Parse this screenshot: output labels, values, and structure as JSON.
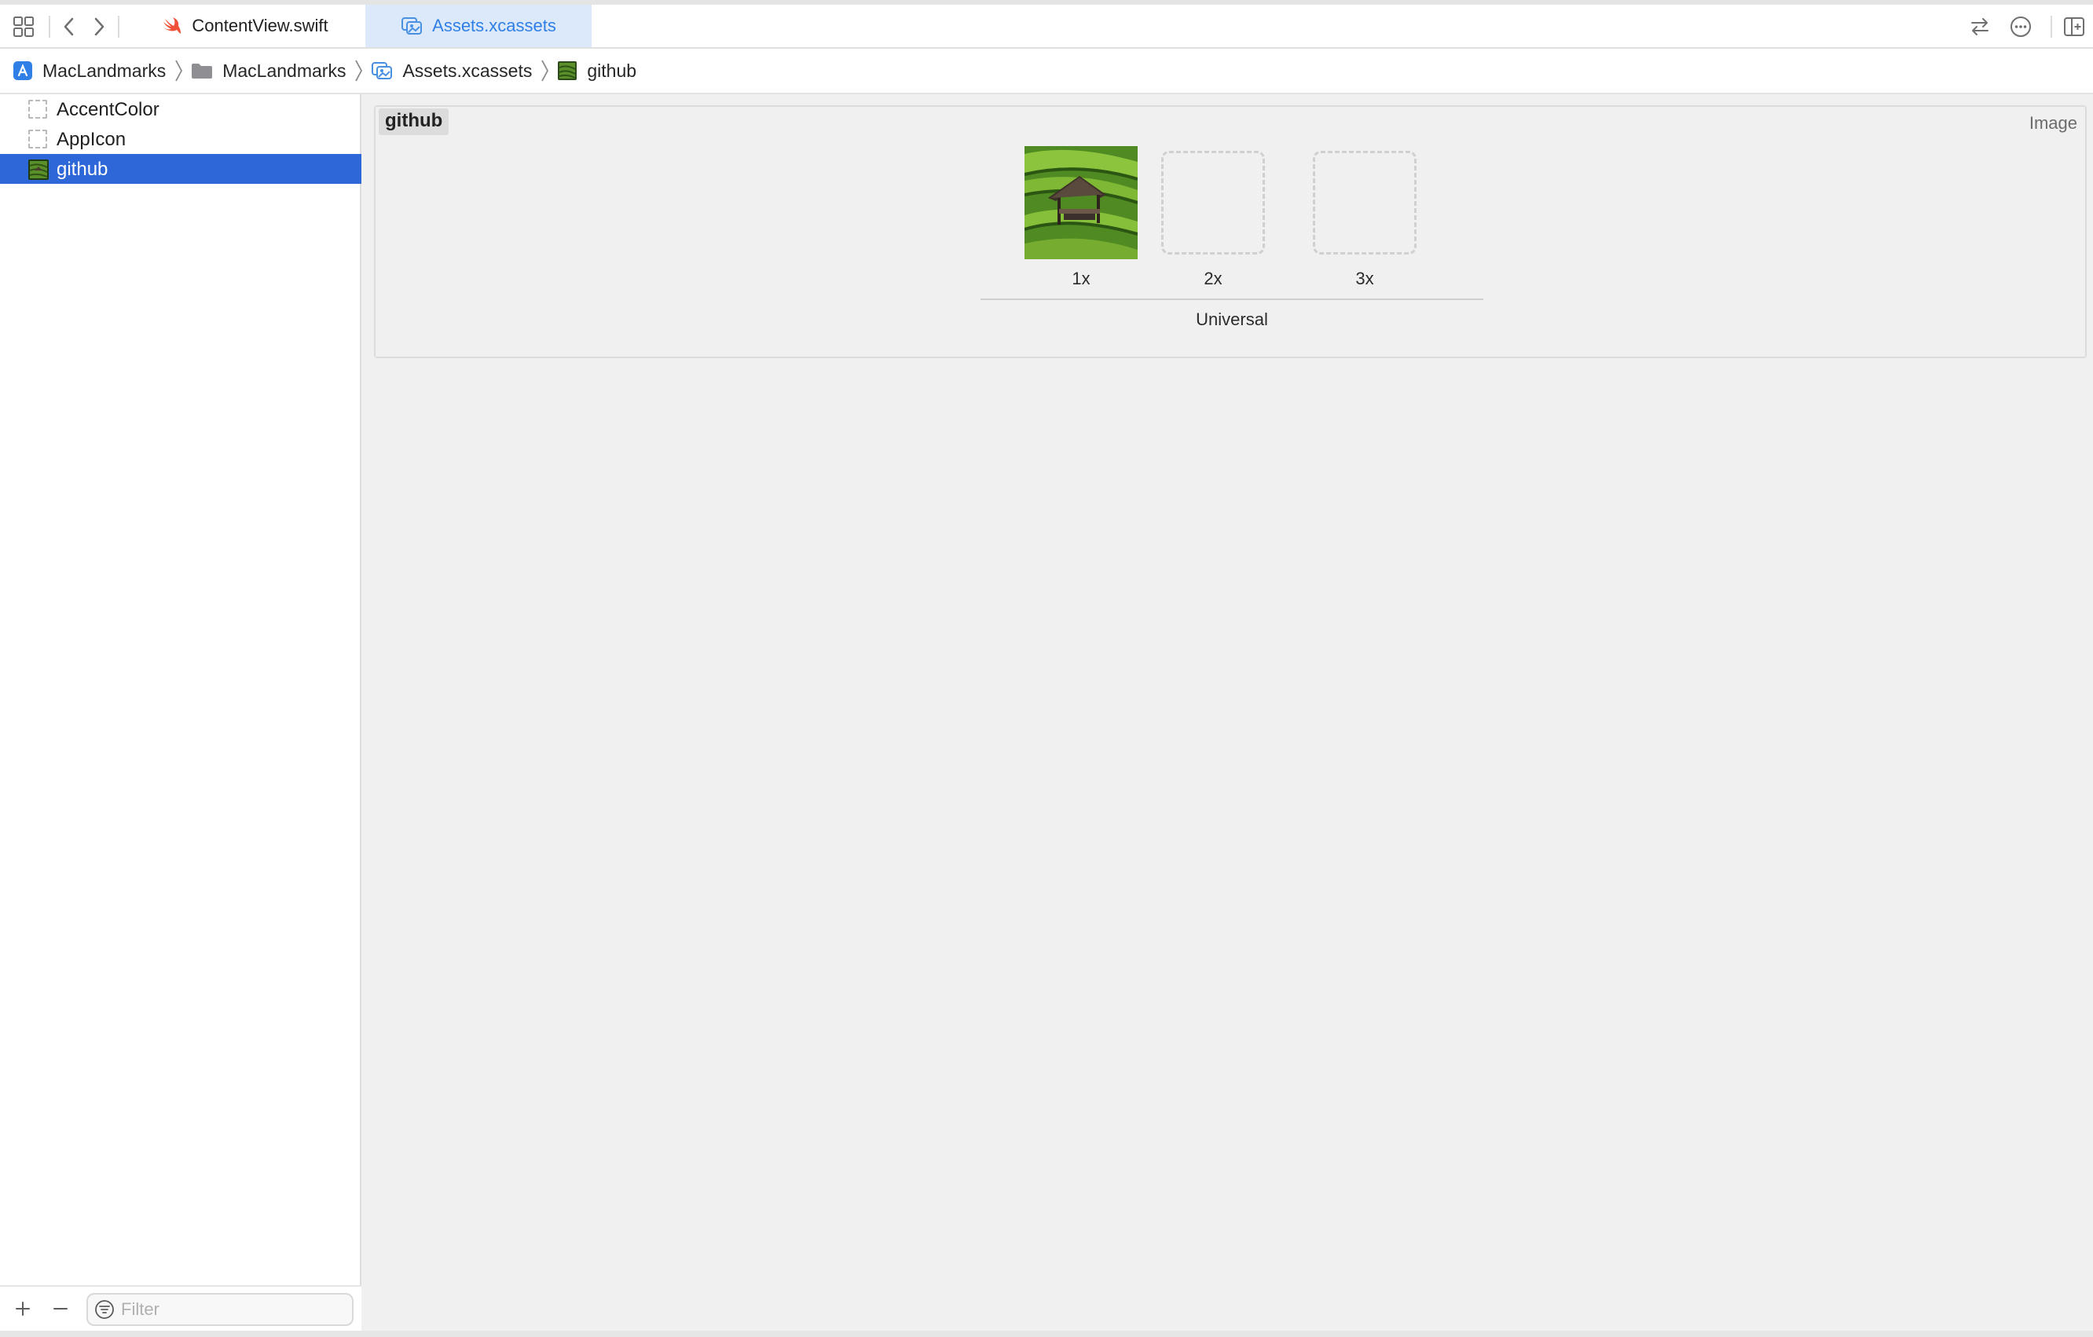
{
  "tabs": [
    {
      "label": "ContentView.swift",
      "icon": "swift-file-icon",
      "active": false
    },
    {
      "label": "Assets.xcassets",
      "icon": "asset-catalog-icon",
      "active": true
    }
  ],
  "breadcrumb": [
    {
      "label": "MacLandmarks",
      "icon": "project-icon"
    },
    {
      "label": "MacLandmarks",
      "icon": "folder-icon"
    },
    {
      "label": "Assets.xcassets",
      "icon": "asset-catalog-icon"
    },
    {
      "label": "github",
      "icon": "image-set-icon"
    }
  ],
  "sidebar": {
    "items": [
      {
        "label": "AccentColor",
        "icon": "color-set-icon",
        "selected": false
      },
      {
        "label": "AppIcon",
        "icon": "app-icon-set-icon",
        "selected": false
      },
      {
        "label": "github",
        "icon": "image-set-icon",
        "selected": true
      }
    ],
    "filter_placeholder": "Filter"
  },
  "editor": {
    "set_name": "github",
    "set_type": "Image",
    "slots": [
      {
        "label": "1x",
        "filled": true
      },
      {
        "label": "2x",
        "filled": false
      },
      {
        "label": "3x",
        "filled": false
      }
    ],
    "group_label": "Universal"
  },
  "colors": {
    "accent": "#2e67d8",
    "active_tab_bg": "#dbe9fa",
    "active_tab_text": "#2f7fe6",
    "editor_bg": "#f0f0f0"
  }
}
